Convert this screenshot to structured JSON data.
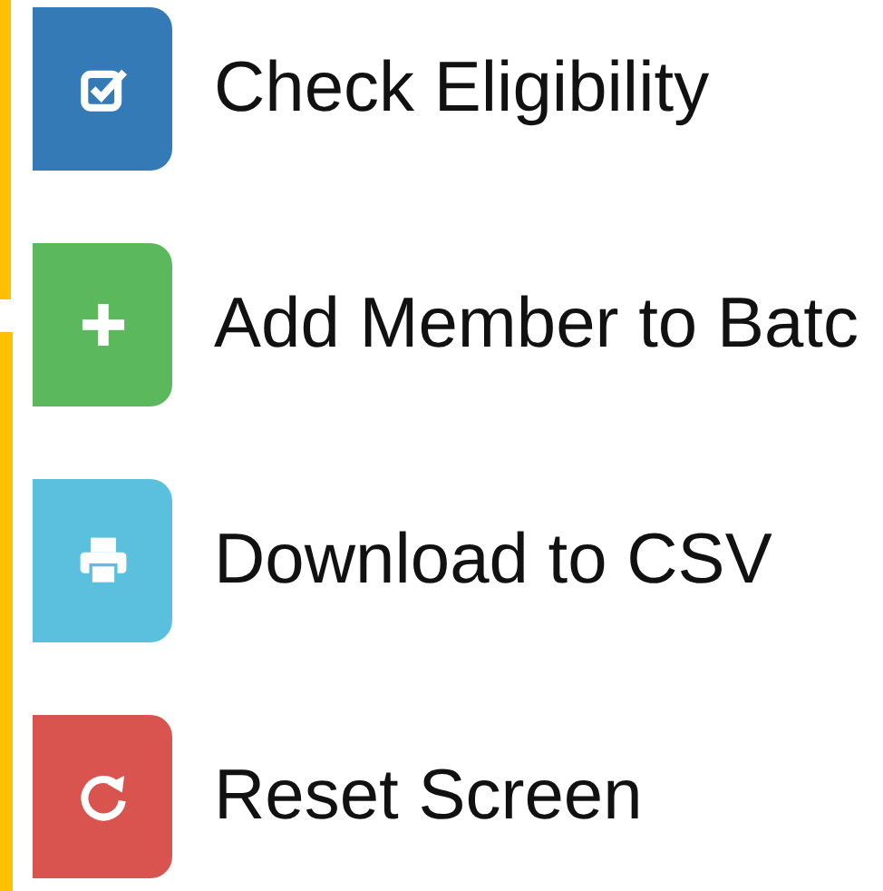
{
  "actions": [
    {
      "kind": "check",
      "color": "#337ab7",
      "label": "Check Eligibility"
    },
    {
      "kind": "add",
      "color": "#5cb85c",
      "label": "Add Member to Batc"
    },
    {
      "kind": "print",
      "color": "#5bc0de",
      "label": "Download to CSV"
    },
    {
      "kind": "reset",
      "color": "#d9534f",
      "label": "Reset Screen"
    }
  ]
}
